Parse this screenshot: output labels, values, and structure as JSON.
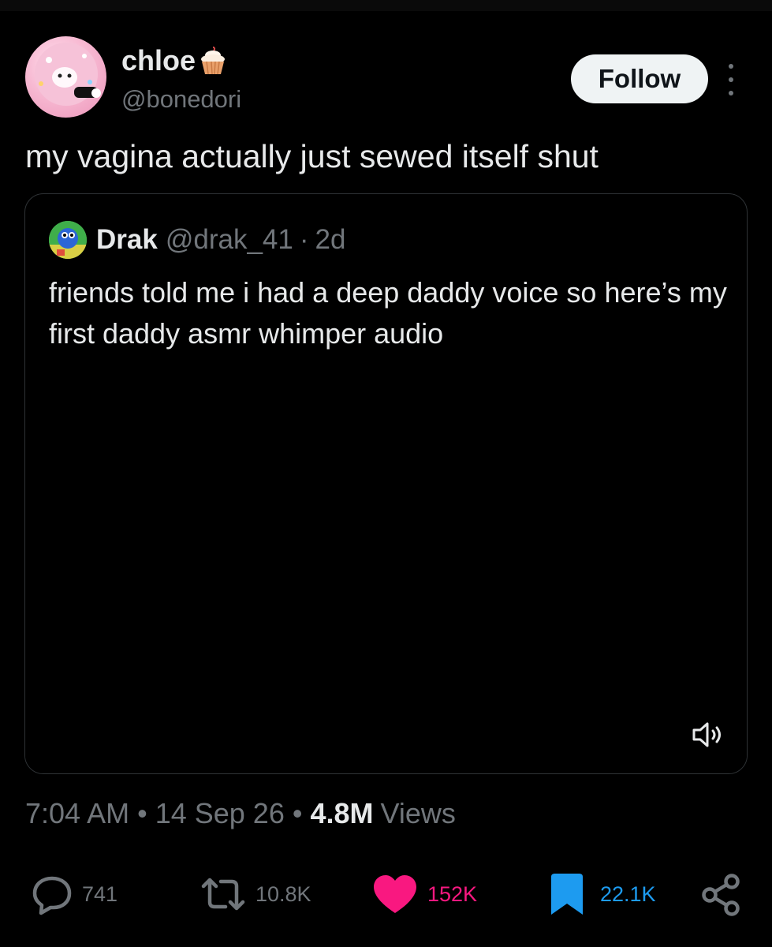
{
  "author": {
    "display_name": "chloe",
    "handle": "@bonedori",
    "follow_label": "Follow"
  },
  "tweet": {
    "text": "my vagina actually just sewed itself shut"
  },
  "quote": {
    "name": "Drak",
    "handle": "@drak_41",
    "separator": "·",
    "time": "2d",
    "text": "friends told me i had a deep daddy voice so here’s my first daddy asmr whimper audio"
  },
  "meta": {
    "time": "7:04 AM",
    "sep1": "•",
    "date": "14 Sep 26",
    "sep2": "•",
    "views_count": "4.8M",
    "views_label": "Views"
  },
  "actions": {
    "replies": "741",
    "retweets": "10.8K",
    "likes": "152K",
    "bookmarks": "22.1K"
  },
  "icons": {
    "reply": "reply-icon",
    "retweet": "retweet-icon",
    "like": "heart-icon",
    "bookmark": "bookmark-icon",
    "share": "share-icon",
    "more": "more-vertical-icon",
    "volume": "volume-icon"
  },
  "colors": {
    "background": "#000000",
    "text": "#e7e9ea",
    "muted": "#71767b",
    "like": "#f91880",
    "bookmark": "#1d9bf0",
    "follow_bg": "#eff3f4"
  }
}
